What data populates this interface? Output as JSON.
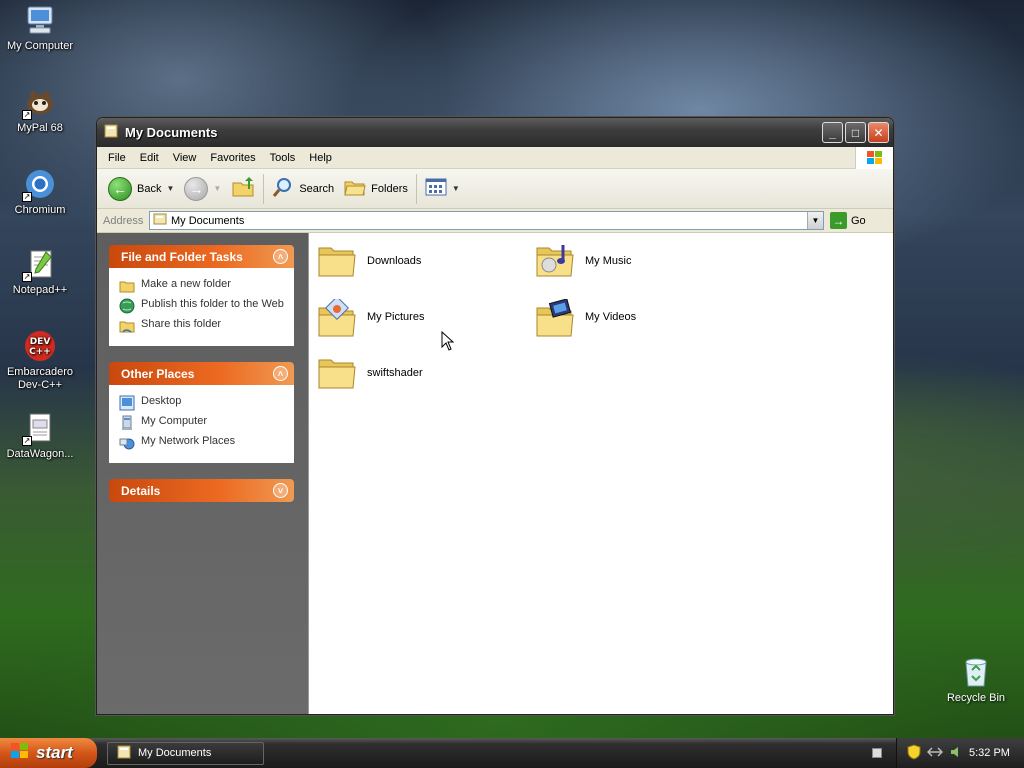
{
  "desktop": {
    "icons": [
      {
        "label": "My Computer"
      },
      {
        "label": "MyPal 68"
      },
      {
        "label": "Chromium"
      },
      {
        "label": "Notepad++"
      },
      {
        "label": "Embarcadero Dev-C++"
      },
      {
        "label": "DataWagon..."
      }
    ],
    "recycle_bin": "Recycle Bin"
  },
  "window": {
    "title": "My Documents",
    "menu": [
      "File",
      "Edit",
      "View",
      "Favorites",
      "Tools",
      "Help"
    ],
    "toolbar": {
      "back": "Back",
      "search": "Search",
      "folders": "Folders"
    },
    "address": {
      "label": "Address",
      "value": "My Documents",
      "go": "Go"
    },
    "taskpane": {
      "file_tasks": {
        "title": "File and Folder Tasks",
        "items": [
          "Make a new folder",
          "Publish this folder to the Web",
          "Share this folder"
        ]
      },
      "other_places": {
        "title": "Other Places",
        "items": [
          "Desktop",
          "My Computer",
          "My Network Places"
        ]
      },
      "details": {
        "title": "Details"
      }
    },
    "items": [
      {
        "label": "Downloads"
      },
      {
        "label": "My Music"
      },
      {
        "label": "My Pictures"
      },
      {
        "label": "My Videos"
      },
      {
        "label": "swiftshader"
      }
    ]
  },
  "taskbar": {
    "start": "start",
    "task": "My Documents",
    "clock": "5:32 PM"
  },
  "colors": {
    "taskpane_header": "#ec6a22",
    "titlebar": "#3d3d3d",
    "start_button": "#d4561a"
  }
}
